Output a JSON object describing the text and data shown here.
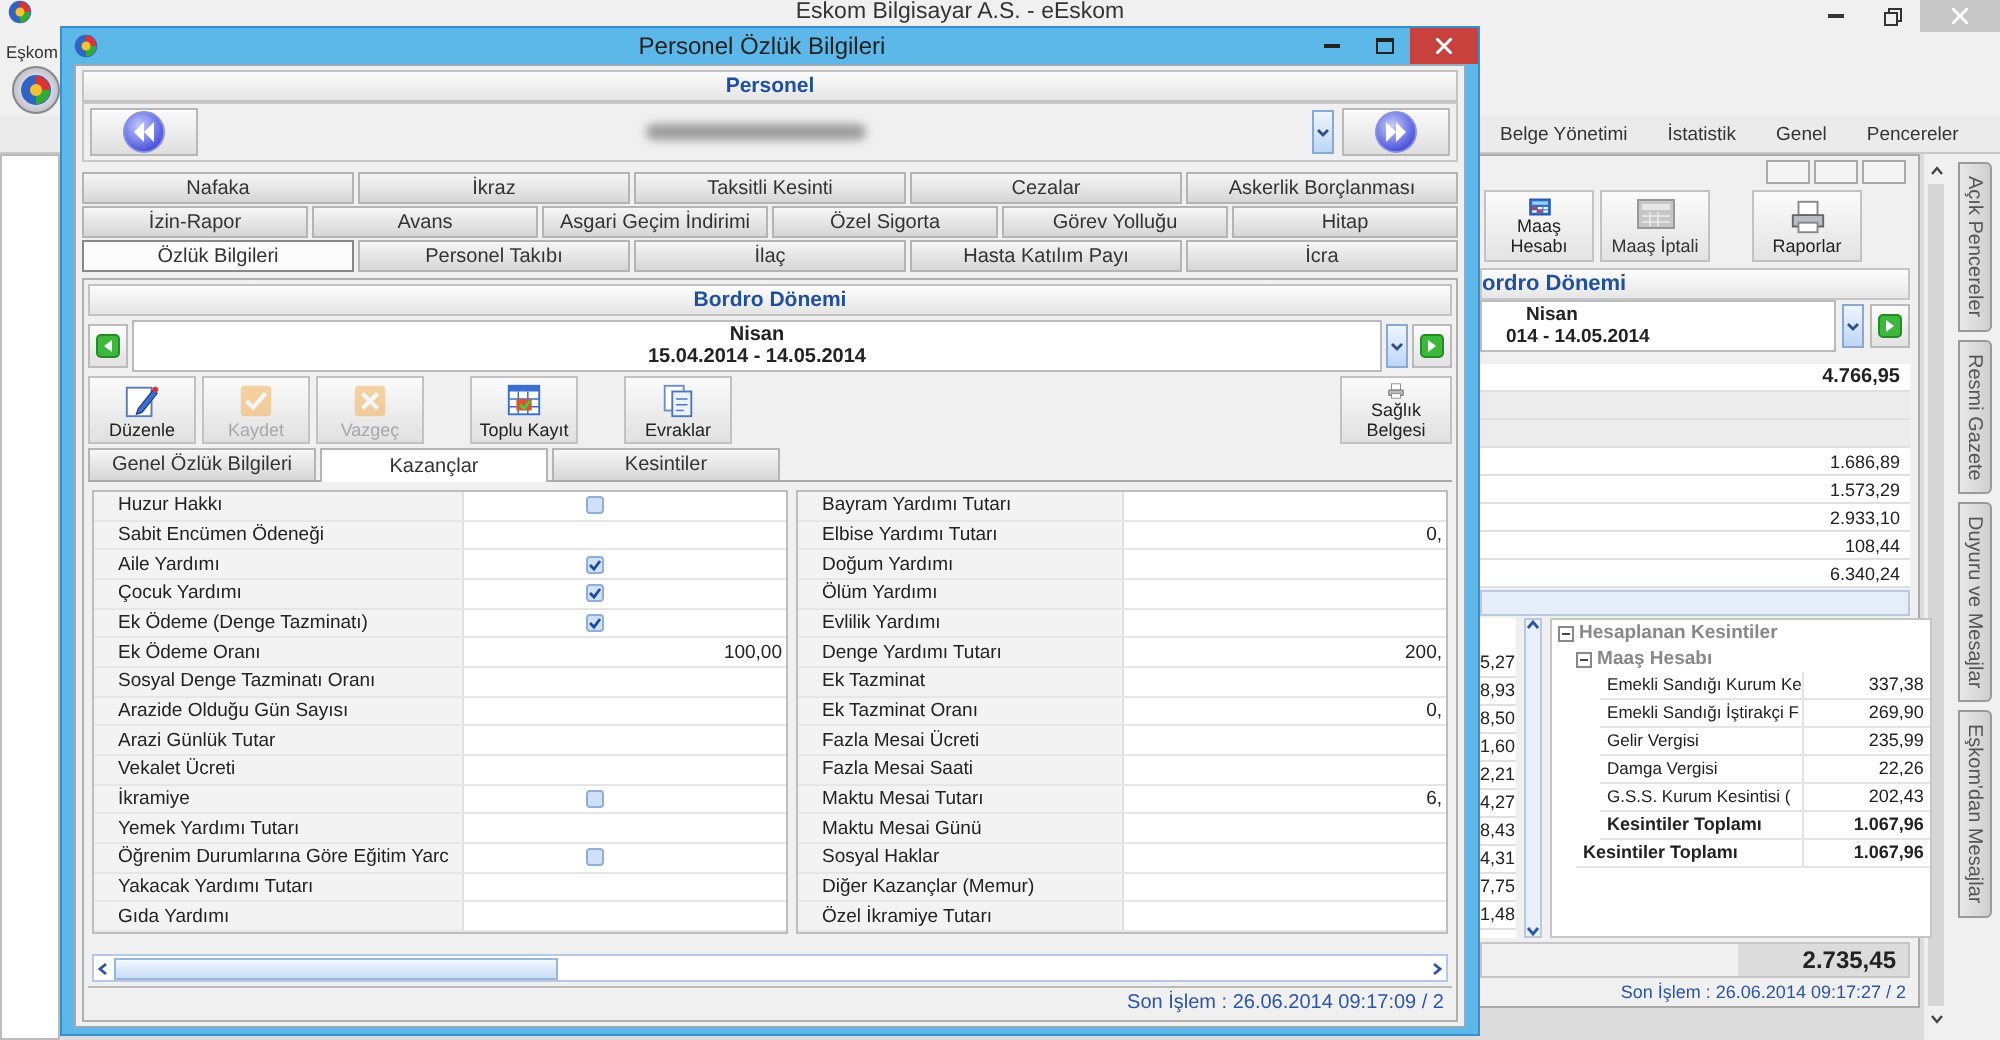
{
  "main_window": {
    "title": "Eskom Bilgisayar A.S. - eEskom",
    "menu": [
      "Eşkom"
    ],
    "ribbon_tabs": [
      "Belge Yönetimi",
      "İstatistik",
      "Genel",
      "Pencereler"
    ],
    "side_tabs": [
      "Açık Pencereler",
      "Resmi Gazete",
      "Duyuru ve Mesajlar",
      "Eşkom'dan Mesajlar"
    ]
  },
  "child_window": {
    "toolbar": [
      {
        "label": "Maaş Hesabı",
        "kind": "calculator",
        "disabled": false
      },
      {
        "label": "Maaş İptali",
        "kind": "calculator",
        "disabled": true
      },
      {
        "label": "Raporlar",
        "kind": "printer",
        "disabled": false
      }
    ],
    "period_header": "ordro Dönemi",
    "period_month": "Nisan",
    "period_range": "014 - 14.05.2014",
    "top_value": "4.766,95",
    "values": [
      "1.686,89",
      "1.573,29",
      "2.933,10",
      "108,44",
      "6.340,24"
    ],
    "left_values": [
      "5,27",
      "8,93",
      "8,50",
      "1,60",
      "2,21",
      "4,27",
      "8,43",
      "4,31",
      "7,75",
      "1,48"
    ],
    "deductions": {
      "title": "Hesaplanan Kesintiler",
      "expanded": true,
      "group": {
        "title": "Maaş Hesabı",
        "expanded": true,
        "rows": [
          {
            "label": "Emekli Sandığı Kurum Ke",
            "value": "337,38"
          },
          {
            "label": "Emekli Sandığı İştirakçi F",
            "value": "269,90"
          },
          {
            "label": "Gelir Vergisi",
            "value": "235,99"
          },
          {
            "label": "Damga Vergisi",
            "value": "22,26"
          },
          {
            "label": "G.S.S. Kurum Kesintisi (",
            "value": "202,43"
          }
        ],
        "total": {
          "label": "Kesintiler Toplamı",
          "value": "1.067,96"
        }
      },
      "total": {
        "label": "Kesintiler Toplamı",
        "value": "1.067,96"
      }
    },
    "grand_total": "2.735,45",
    "status": "Son İşlem : 26.06.2014 09:17:27 / 2"
  },
  "dialog": {
    "title": "Personel Özlük Bilgileri",
    "personnel_header": "Personel",
    "tab_rows": [
      {
        "tabs": [
          {
            "label": "Nafaka",
            "selected": false
          },
          {
            "label": "İkraz",
            "selected": false
          },
          {
            "label": "Taksitli Kesinti",
            "selected": false
          },
          {
            "label": "Cezalar",
            "selected": false
          },
          {
            "label": "Askerlik Borçlanması",
            "selected": false
          }
        ]
      },
      {
        "tabs": [
          {
            "label": "İzin-Rapor",
            "selected": false
          },
          {
            "label": "Avans",
            "selected": false
          },
          {
            "label": "Asgari Geçim İndirimi",
            "selected": false
          },
          {
            "label": "Özel Sigorta",
            "selected": false
          },
          {
            "label": "Görev Yolluğu",
            "selected": false
          },
          {
            "label": "Hitap",
            "selected": false
          }
        ]
      },
      {
        "tabs": [
          {
            "label": "Özlük Bilgileri",
            "selected": true
          },
          {
            "label": "Personel Takıbı",
            "selected": false
          },
          {
            "label": "İlaç",
            "selected": false
          },
          {
            "label": "Hasta Katılım Payı",
            "selected": false
          },
          {
            "label": "İcra",
            "selected": false
          }
        ]
      }
    ],
    "period": {
      "header": "Bordro Dönemi",
      "month": "Nisan",
      "range": "15.04.2014 - 14.05.2014"
    },
    "toolbar": [
      {
        "label": "Düzenle",
        "kind": "edit",
        "disabled": false
      },
      {
        "label": "Kaydet",
        "kind": "check",
        "disabled": true
      },
      {
        "label": "Vazgeç",
        "kind": "cancel",
        "disabled": true
      },
      {
        "label": "Toplu Kayıt",
        "kind": "grid",
        "disabled": false
      },
      {
        "label": "Evraklar",
        "kind": "documents",
        "disabled": false
      },
      {
        "label": "Sağlık Belgesi",
        "kind": "printer",
        "disabled": false
      }
    ],
    "sub_tabs": [
      {
        "label": "Genel Özlük Bilgileri",
        "selected": false
      },
      {
        "label": "Kazançlar",
        "selected": true
      },
      {
        "label": "Kesintiler",
        "selected": false
      }
    ],
    "earnings_left": [
      {
        "label": "Huzur Hakkı",
        "kind": "checkbox",
        "checked": false
      },
      {
        "label": "Sabit Encümen Ödeneği",
        "kind": "empty"
      },
      {
        "label": "Aile Yardımı",
        "kind": "checkbox",
        "checked": true
      },
      {
        "label": "Çocuk Yardımı",
        "kind": "checkbox",
        "checked": true
      },
      {
        "label": "Ek Ödeme (Denge Tazminatı)",
        "kind": "checkbox",
        "checked": true
      },
      {
        "label": "Ek Ödeme Oranı",
        "kind": "text",
        "value": "100,00"
      },
      {
        "label": "Sosyal Denge Tazminatı Oranı",
        "kind": "empty"
      },
      {
        "label": "Arazide Olduğu Gün Sayısı",
        "kind": "empty"
      },
      {
        "label": "Arazi Günlük Tutar",
        "kind": "empty"
      },
      {
        "label": "Vekalet Ücreti",
        "kind": "empty"
      },
      {
        "label": "İkramiye",
        "kind": "checkbox",
        "checked": false
      },
      {
        "label": "Yemek Yardımı Tutarı",
        "kind": "empty"
      },
      {
        "label": "Öğrenim Durumlarına Göre Eğitim Yarc",
        "kind": "checkbox",
        "checked": false
      },
      {
        "label": "Yakacak Yardımı Tutarı",
        "kind": "empty"
      },
      {
        "label": "Gıda Yardımı",
        "kind": "empty"
      }
    ],
    "earnings_right": [
      {
        "label": "Bayram Yardımı Tutarı",
        "kind": "empty"
      },
      {
        "label": "Elbise Yardımı Tutarı",
        "kind": "text",
        "value": "0,"
      },
      {
        "label": "Doğum Yardımı",
        "kind": "empty"
      },
      {
        "label": "Ölüm Yardımı",
        "kind": "empty"
      },
      {
        "label": "Evlilik Yardımı",
        "kind": "empty"
      },
      {
        "label": "Denge Yardımı Tutarı",
        "kind": "text",
        "value": "200,"
      },
      {
        "label": "Ek Tazminat",
        "kind": "empty"
      },
      {
        "label": "Ek Tazminat Oranı",
        "kind": "text",
        "value": "0,"
      },
      {
        "label": "Fazla Mesai Ücreti",
        "kind": "empty"
      },
      {
        "label": "Fazla Mesai Saati",
        "kind": "empty"
      },
      {
        "label": "Maktu Mesai Tutarı",
        "kind": "text",
        "value": "6,"
      },
      {
        "label": "Maktu Mesai Günü",
        "kind": "empty"
      },
      {
        "label": "Sosyal Haklar",
        "kind": "empty"
      },
      {
        "label": "Diğer Kazançlar (Memur)",
        "kind": "empty"
      },
      {
        "label": "Özel İkramiye Tutarı",
        "kind": "empty"
      }
    ],
    "status": "Son İşlem : 26.06.2014 09:17:09 / 2"
  }
}
